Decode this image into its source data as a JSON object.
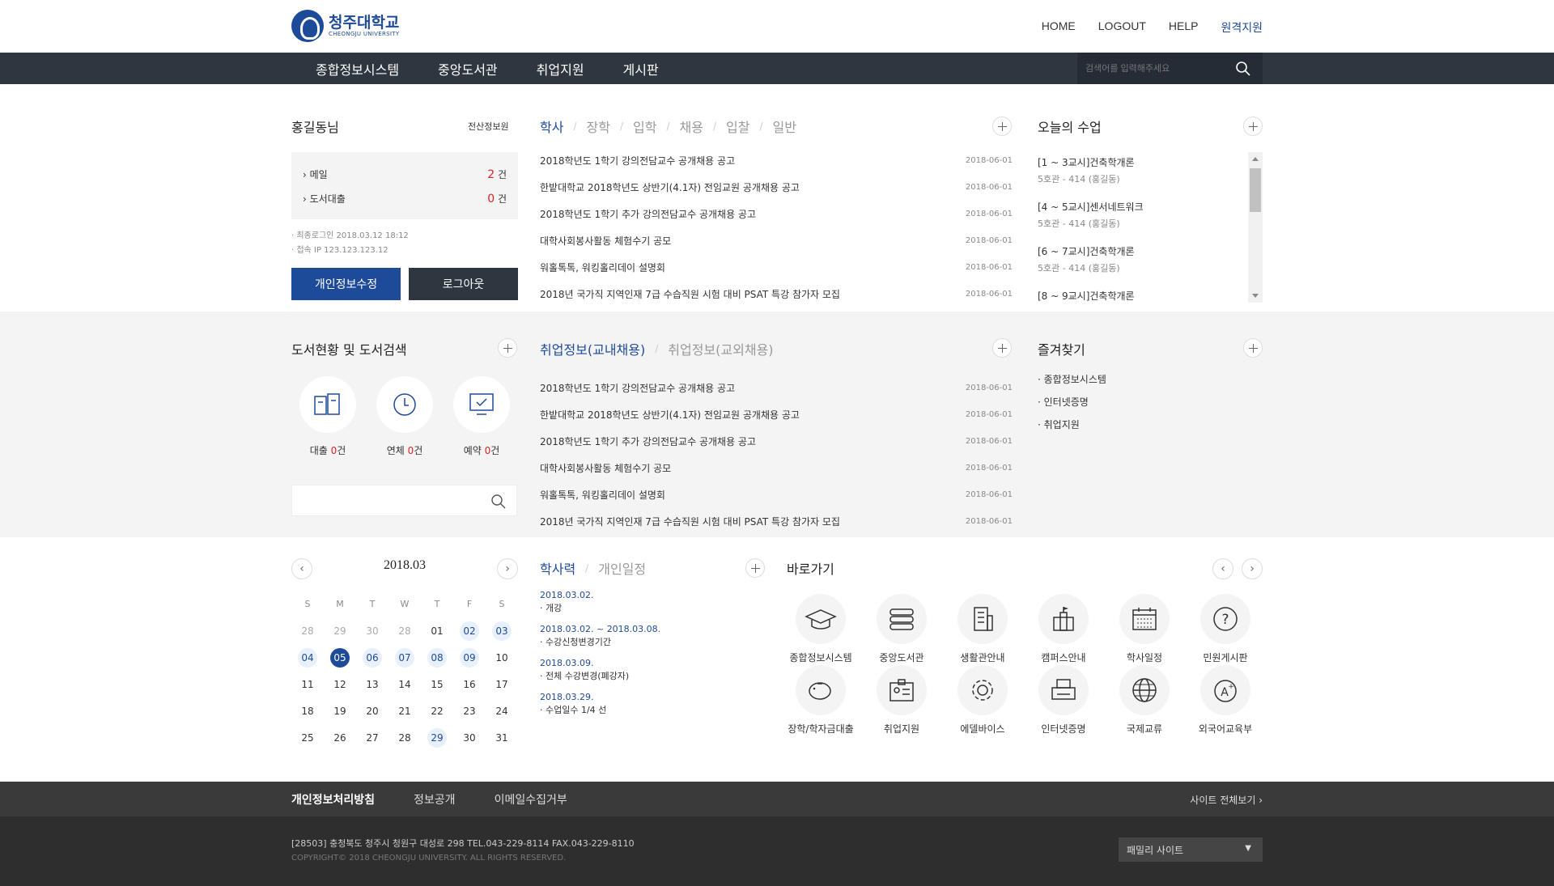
{
  "header": {
    "logo": {
      "ko": "청주대학교",
      "en": "CHEONGJU UNIVERSITY"
    },
    "nav": [
      "HOME",
      "LOGOUT",
      "HELP",
      "원격지원"
    ]
  },
  "gnb": {
    "menu": [
      "종합정보시스템",
      "중앙도서관",
      "취업지원",
      "게시판"
    ],
    "search_placeholder": "검색어를 입력해주세요"
  },
  "user": {
    "name": "홍길동님",
    "dept": "전산정보원",
    "mail_label": "메일",
    "mail_count": "2",
    "mail_unit": "건",
    "loan_label": "도서대출",
    "loan_count": "0",
    "loan_unit": "건",
    "last_login": "· 최종로그인 2018.03.12 18:12",
    "ip": "· 접속 IP 123.123.123.12",
    "btn_profile": "개인정보수정",
    "btn_logout": "로그아웃"
  },
  "notice": {
    "tabs": [
      "학사",
      "장학",
      "입학",
      "채용",
      "입찰",
      "일반"
    ],
    "items": [
      {
        "title": "2018학년도 1학기 강의전담교수 공개채용 공고",
        "date": "2018-06-01"
      },
      {
        "title": "한밭대학교 2018학년도 상반기(4.1자) 전임교원 공개채용 공고",
        "date": "2018-06-01"
      },
      {
        "title": "2018학년도 1학기 추가 강의전담교수 공개채용 공고",
        "date": "2018-06-01"
      },
      {
        "title": "대학사회봉사활동 체험수기 공모",
        "date": "2018-06-01"
      },
      {
        "title": "워홀톡톡, 워킹홀리데이 설명회",
        "date": "2018-06-01"
      },
      {
        "title": "2018년 국가직 지역인재 7급 수습직원 시험 대비 PSAT 특강 참가자 모집",
        "date": "2018-06-01"
      }
    ]
  },
  "today": {
    "title": "오늘의 수업",
    "classes": [
      {
        "name": "[1 ~ 3교시]건축학개론",
        "room": "5호관 - 414 (홍길동)"
      },
      {
        "name": "[4 ~ 5교시]센서네트워크",
        "room": "5호관 - 414 (홍길동)"
      },
      {
        "name": "[6 ~ 7교시]건축학개론",
        "room": "5호관 - 414 (홍길동)"
      },
      {
        "name": "[8 ~ 9교시]건축학개론",
        "room": ""
      }
    ]
  },
  "library": {
    "title": "도서현황 및 도서검색",
    "stats": [
      {
        "label": "대출",
        "count": "0",
        "unit": "건",
        "icon": "book-icon"
      },
      {
        "label": "연체",
        "count": "0",
        "unit": "건",
        "icon": "clock-icon"
      },
      {
        "label": "예약",
        "count": "0",
        "unit": "건",
        "icon": "monitor-check-icon"
      }
    ]
  },
  "jobs": {
    "tabs": [
      "취업정보(교내채용)",
      "취업정보(교외채용)"
    ],
    "items": [
      {
        "title": "2018학년도 1학기 강의전담교수 공개채용 공고",
        "date": "2018-06-01"
      },
      {
        "title": "한밭대학교 2018학년도 상반기(4.1자) 전임교원 공개채용 공고",
        "date": "2018-06-01"
      },
      {
        "title": "2018학년도 1학기 추가 강의전담교수 공개채용 공고",
        "date": "2018-06-01"
      },
      {
        "title": "대학사회봉사활동 체험수기 공모",
        "date": "2018-06-01"
      },
      {
        "title": "워홀톡톡, 워킹홀리데이 설명회",
        "date": "2018-06-01"
      },
      {
        "title": "2018년 국가직 지역인재 7급 수습직원 시험 대비 PSAT 특강 참가자 모집",
        "date": "2018-06-01"
      }
    ]
  },
  "favorites": {
    "title": "즐겨찾기",
    "items": [
      "· 종합정보시스템",
      "· 인터넷증명",
      "· 취업지원"
    ]
  },
  "calendar": {
    "month": "2018.03",
    "weekdays": [
      "S",
      "M",
      "T",
      "W",
      "T",
      "F",
      "S"
    ],
    "weeks": [
      [
        "28",
        "29",
        "30",
        "28",
        "01",
        "02",
        "03"
      ],
      [
        "04",
        "05",
        "06",
        "07",
        "08",
        "09",
        "10"
      ],
      [
        "11",
        "12",
        "13",
        "14",
        "15",
        "16",
        "17"
      ],
      [
        "18",
        "19",
        "20",
        "21",
        "22",
        "23",
        "24"
      ],
      [
        "25",
        "26",
        "27",
        "28",
        "29",
        "30",
        "31"
      ]
    ]
  },
  "schedule": {
    "tabs": [
      "학사력",
      "개인일정"
    ],
    "events": [
      {
        "date": "2018.03.02.",
        "text": "· 개강"
      },
      {
        "date": "2018.03.02. ~ 2018.03.08.",
        "text": "· 수강신청변경기간"
      },
      {
        "date": "2018.03.09.",
        "text": "· 전체 수강변경(폐강자)"
      },
      {
        "date": "2018.03.29.",
        "text": "· 수업일수 1/4 선"
      }
    ]
  },
  "quick": {
    "title": "바로가기",
    "items": [
      {
        "label": "종합정보시스템",
        "icon": "graduation-cap-icon"
      },
      {
        "label": "중앙도서관",
        "icon": "books-icon"
      },
      {
        "label": "생활관안내",
        "icon": "building-icon"
      },
      {
        "label": "캠퍼스안내",
        "icon": "campus-flag-icon"
      },
      {
        "label": "학사일정",
        "icon": "calendar-icon"
      },
      {
        "label": "민원게시판",
        "icon": "question-icon"
      },
      {
        "label": "장학/학자금대출",
        "icon": "piggy-bank-icon"
      },
      {
        "label": "취업지원",
        "icon": "id-card-icon"
      },
      {
        "label": "에델바이스",
        "icon": "gear-icon"
      },
      {
        "label": "인터넷증명",
        "icon": "printer-icon"
      },
      {
        "label": "국제교류",
        "icon": "globe-icon"
      },
      {
        "label": "외국어교육부",
        "icon": "a-plus-icon"
      }
    ]
  },
  "footer": {
    "links": [
      "개인정보처리방침",
      "정보공개",
      "이메일수집거부"
    ],
    "sitemap": "사이트 전체보기 ›",
    "address": "[28503] 충청북도 청주시 청원구 대성로 298    TEL.043-229-8114    FAX.043-229-8110",
    "copyright": "COPYRIGHT© 2018 CHEONGJU UNIVERSITY. ALL RIGHTS RESERVED.",
    "family": "패밀리 사이트"
  },
  "colors": {
    "primary": "#1e4a9a",
    "dark": "#2e3640",
    "accent_red": "#dd2222"
  }
}
